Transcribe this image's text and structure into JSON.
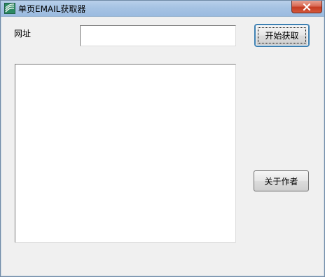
{
  "window": {
    "title": "单页EMAIL获取器",
    "close_label": "close"
  },
  "form": {
    "url_label": "网址",
    "url_value": "",
    "start_button": "开始获取",
    "about_button": "关于作者",
    "result_text": ""
  },
  "colors": {
    "window_bg": "#f0f0f0",
    "title_bar": "#a6c3e3",
    "close_button": "#c53b22"
  },
  "icons": {
    "app": "app-icon",
    "close": "close-icon"
  }
}
